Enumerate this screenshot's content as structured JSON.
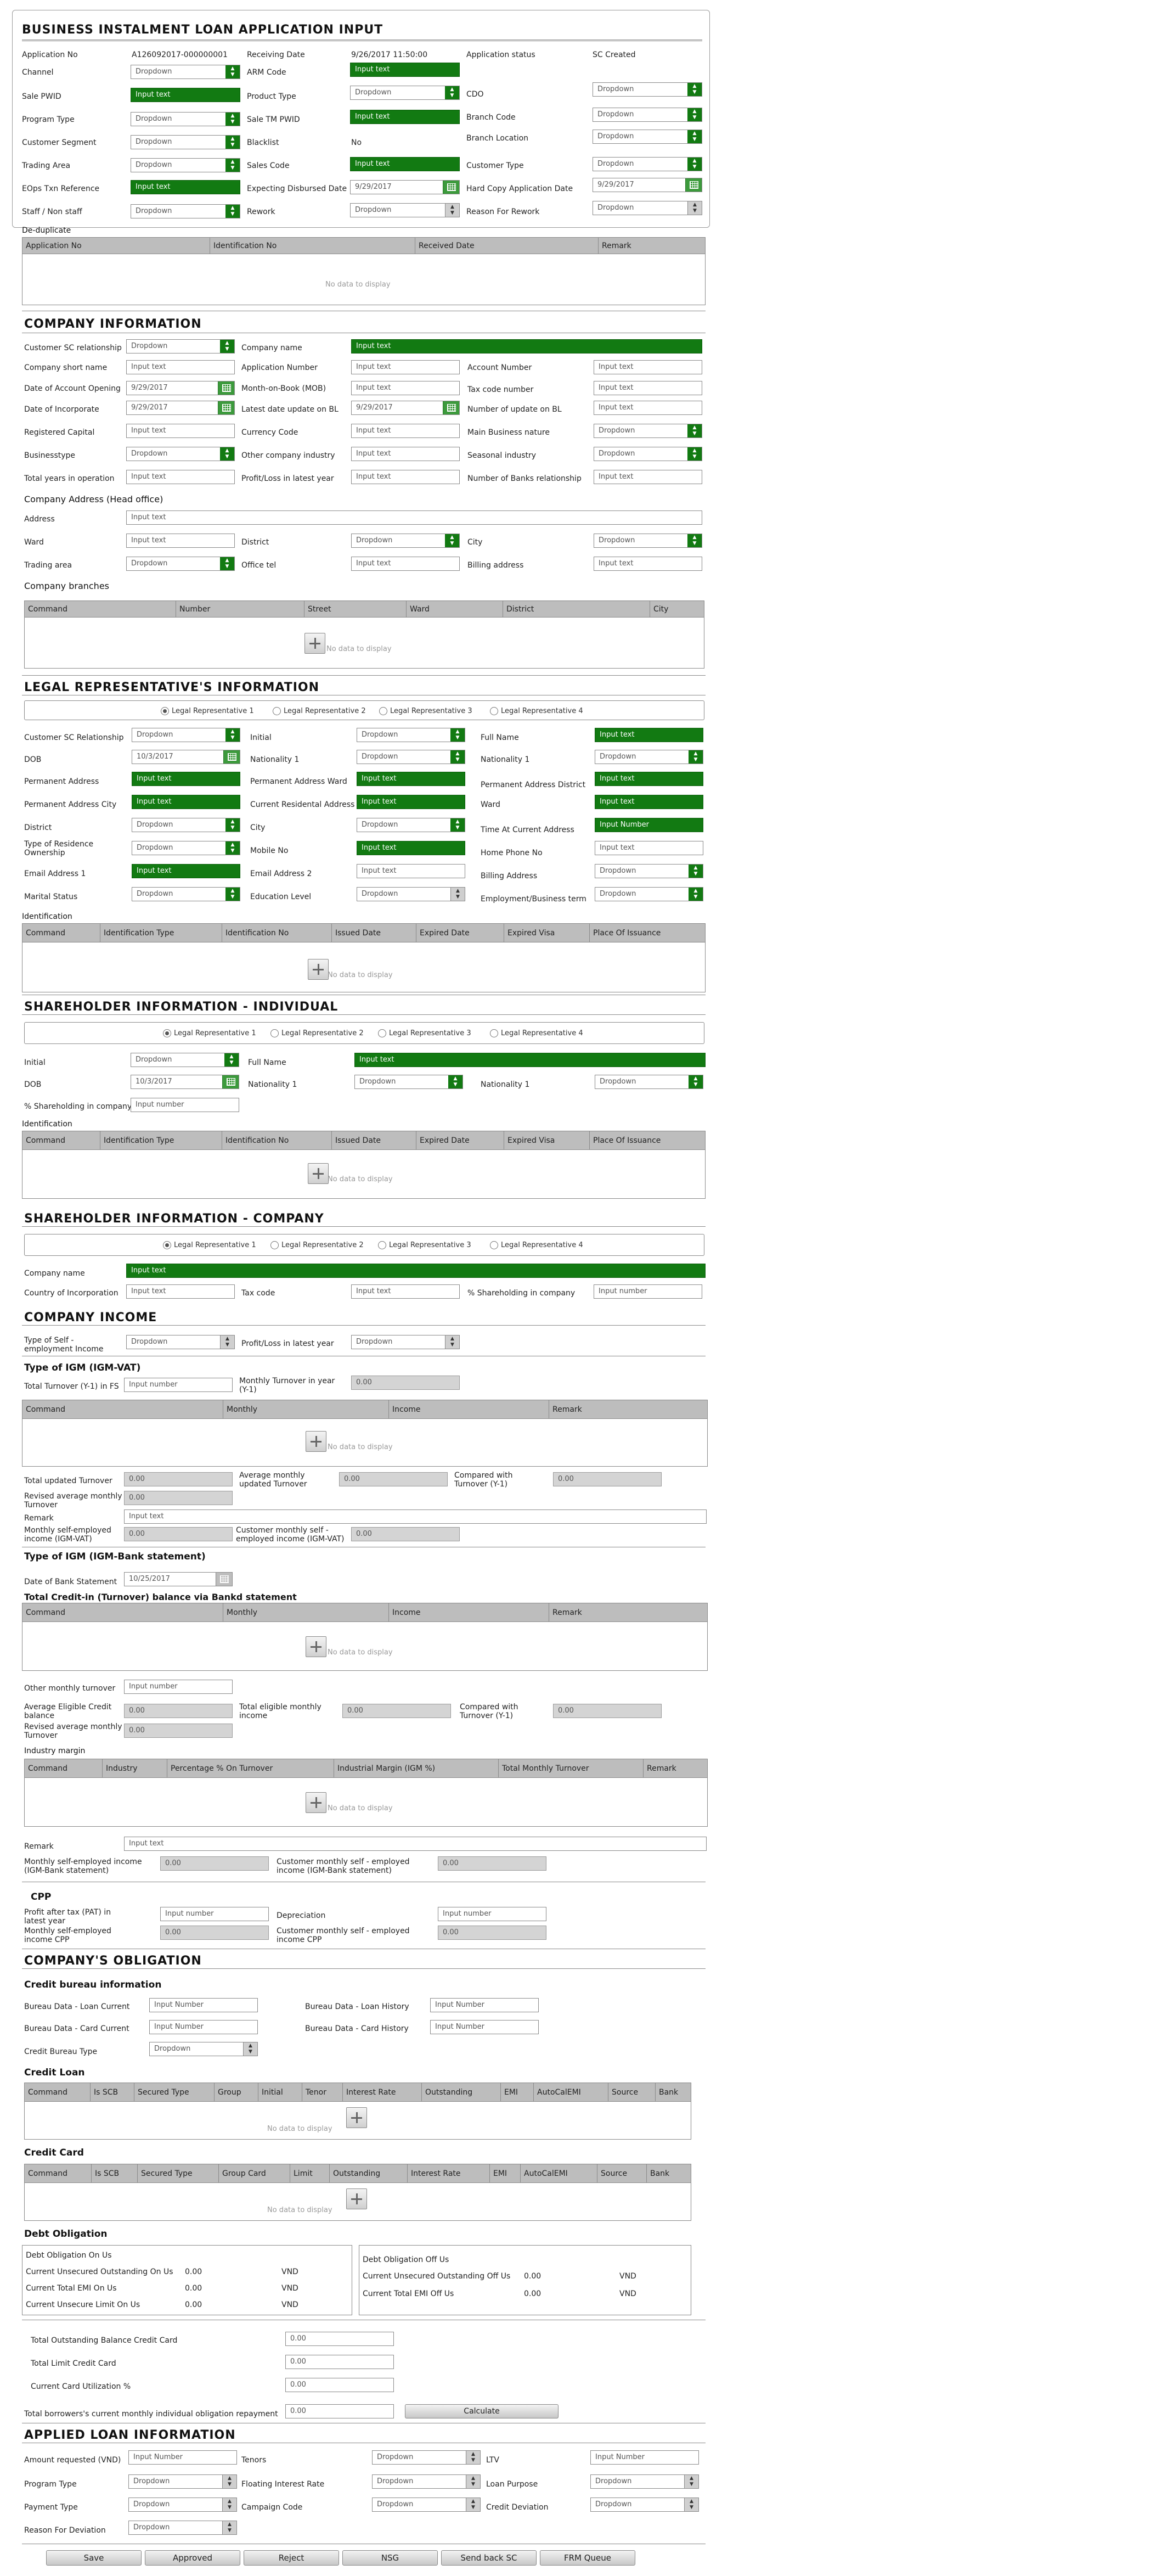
{
  "header": {
    "title": "BUSINESS INSTALMENT LOAN APPLICATION INPUT",
    "app_no_label": "Application No",
    "app_no": "A1260920​17-000000001",
    "receiving_date_label": "Receiving Date",
    "receiving_date": "9/26/2017 11:50:00",
    "app_status_label": "Application status",
    "app_status": "SC Created",
    "channel": "Channel",
    "arm_code": "ARM Code",
    "sale_pwid": "Sale PWID",
    "product_type": "Product Type",
    "cdo": "CDO",
    "program_type": "Program Type",
    "sale_tm_pwid": "Sale TM PWID",
    "branch_code": "Branch Code",
    "customer_segment": "Customer Segment",
    "blacklist": "Blacklist",
    "blacklist_val": "No",
    "branch_location": "Branch Location",
    "trading_area": "Trading Area",
    "sales_code": "Sales Code",
    "customer_type": "Customer Type",
    "eops_ref": "EOps Txn Reference",
    "expecting_date": "Expecting Disbursed Date",
    "expecting_date_val": "9/29/2017",
    "hardcopy_date": "Hard Copy Application Date",
    "hardcopy_date_val": "9/29/2017",
    "staff": "Staff / Non staff",
    "rework": "Rework",
    "reason_rework": "Reason For Rework"
  },
  "common": {
    "dropdown": "Dropdown",
    "input_text": "Input text",
    "input_number": "Input number",
    "input_number_cap": "Input Number",
    "no_data": "No data to display",
    "zero": "0.00",
    "vnd": "VND"
  },
  "dedup": {
    "title": "De-duplicate",
    "cols": [
      "Application No",
      "Identification No",
      "Received Date",
      "Remark"
    ]
  },
  "company": {
    "title": "COMPANY INFORMATION",
    "customer_sc_rel": "Customer SC relationship",
    "company_name": "Company name",
    "short_name": "Company short name",
    "application_number": "Application Number",
    "account_number": "Account Number",
    "date_account_opening": "Date of Account Opening",
    "date_account_opening_val": "9/29/2017",
    "mob": "Month-on-Book (MOB)",
    "tax_code_number": "Tax code number",
    "date_incorporate": "Date of Incorporate",
    "date_incorporate_val": "9/29/2017",
    "latest_update": "Latest date update on BL",
    "latest_update_val": "9/29/2017",
    "num_update": "Number of update on BL",
    "registered_capital": "Registered Capital",
    "currency_code": "Currency Code",
    "main_business": "Main Business nature",
    "business_type": "Businesstype",
    "other_industry": "Other company industry",
    "seasonal": "Seasonal industry",
    "total_years": "Total years in operation",
    "profit_loss": "Profit/Loss in latest year",
    "num_banks": "Number of Banks relationship",
    "address_title": "Company Address (Head office)",
    "address": "Address",
    "ward": "Ward",
    "district": "District",
    "city": "City",
    "trading_area": "Trading area",
    "office_tel": "Office tel",
    "billing_address": "Billing address",
    "branches_title": "Company branches",
    "branch_cols": [
      "Command",
      "Number",
      "Street",
      "Ward",
      "District",
      "City"
    ]
  },
  "legal": {
    "title": "LEGAL REPRESENTATIVE'S INFORMATION",
    "radios": [
      "Legal Representative 1",
      "Legal Representative 2",
      "Legal Representative 3",
      "Legal Representative 4"
    ],
    "customer_sc_rel": "Customer SC Relationship",
    "initial": "Initial",
    "full_name": "Full Name",
    "dob": "DOB",
    "dob_val": "10/3/2017",
    "nationality1": "Nationality 1",
    "perm_address": "Permanent Address",
    "perm_ward": "Permanent Address Ward",
    "perm_district": "Permanent Address District",
    "perm_city": "Permanent Address City",
    "current_address": "Current Residental Address",
    "ward": "Ward",
    "district": "District",
    "city": "City",
    "time_current": "Time At Current Address",
    "input_number_cap": "Input Number",
    "residence_type": "Type of Residence Ownership",
    "mobile_no": "Mobile No",
    "home_phone": "Home Phone No",
    "email1": "Email Address 1",
    "email2": "Email Address 2",
    "billing_address": "Billing Address",
    "marital": "Marital Status",
    "education": "Education Level",
    "employment": "Employment/Business term",
    "ident_title": "Identification",
    "ident_cols": [
      "Command",
      "Identification Type",
      "Identification No",
      "Issued Date",
      "Expired Date",
      "Expired Visa",
      "Place Of Issuance"
    ]
  },
  "sh_ind": {
    "title": "SHAREHOLDER INFORMATION - INDIVIDUAL",
    "initial": "Initial",
    "full_name": "Full Name",
    "dob": "DOB",
    "dob_val": "10/3/2017",
    "nationality1": "Nationality 1",
    "nationality1b": "Nationality 1",
    "pct": "% Shareholding in company",
    "ident_title": "Identification"
  },
  "sh_co": {
    "title": "SHAREHOLDER INFORMATION - COMPANY",
    "company_name": "Company name",
    "country": "Country of Incorporation",
    "tax_code": "Tax code",
    "pct": "% Shareholding in company"
  },
  "income": {
    "title": "COMPANY INCOME",
    "type_self": "Type of Self - employment Income",
    "profit_loss": "Profit/Loss in latest year",
    "igm_vat_title": "Type of IGM (IGM-VAT)",
    "total_turnover": "Total Turnover (Y-1) in FS",
    "monthly_turnover": "Monthly Turnover in year (Y-1)",
    "vat_cols": [
      "Command",
      "Monthly",
      "Income",
      "Remark"
    ],
    "updated_turnover": "Total updated Turnover",
    "avg_monthly": "Average monthly updated Turnover",
    "compared": "Compared with Turnover (Y-1)",
    "revised_avg": "Revised average monthly Turnover",
    "remark": "Remark",
    "monthly_self_vat": "Monthly self-employed income (IGM-VAT)",
    "customer_monthly_vat": "Customer monthly self - employed income (IGM-VAT)",
    "igm_bank_title": "Type of IGM (IGM-Bank statement)",
    "date_bank": "Date of Bank Statement",
    "date_bank_val": "10/25/2017",
    "credit_title": "Total Credit-in (Turnover) balance via Bankd statement",
    "other_turnover": "Other monthly turnover",
    "avg_credit": "Average Eligible Credit balance",
    "total_eligible": "Total eligible monthly income",
    "compared2": "Compared with Turnover (Y-1)",
    "revised_avg2": "Revised average monthly Turnover",
    "industry_title": "Industry margin",
    "industry_cols": [
      "Command",
      "Industry",
      "Percentage % On Turnover",
      "Industrial Margin (IGM %)",
      "Total Monthly Turnover",
      "Remark"
    ],
    "monthly_self_bank": "Monthly self-employed income (IGM-Bank statement)",
    "customer_monthly_bank": "Customer monthly self - employed income (IGM-Bank statement)",
    "cpp_title": "CPP",
    "pat": "Profit after tax (PAT) in latest year",
    "depreciation": "Depreciation",
    "monthly_cpp": "Monthly self-employed income CPP",
    "customer_cpp": "Customer monthly self - employed income CPP"
  },
  "obligation": {
    "title": "COMPANY'S OBLIGATION",
    "bureau_title": "Credit bureau information",
    "bureau_loan_current": "Bureau Data - Loan Current",
    "bureau_loan_history": "Bureau Data - Loan History",
    "bureau_card_current": "Bureau Data - Card Current",
    "bureau_card_history": "Bureau Data - Card History",
    "bureau_type": "Credit Bureau Type",
    "credit_loan_title": "Credit Loan",
    "loan_cols": [
      "Command",
      "Is SCB",
      "Secured Type",
      "Group",
      "Initial",
      "Tenor",
      "Interest Rate",
      "Outstanding",
      "EMI",
      "AutoCalEMI",
      "Source",
      "Bank"
    ],
    "credit_card_title": "Credit Card",
    "card_cols": [
      "Command",
      "Is SCB",
      "Secured Type",
      "Group Card",
      "Limit",
      "Outstanding",
      "Interest Rate",
      "EMI",
      "AutoCalEMI",
      "Source",
      "Bank"
    ],
    "debt_title": "Debt Obligation",
    "on_us_title": "Debt Obligation On Us",
    "off_us_title": "Debt Obligation Off Us",
    "cur_unsec_on": "Current Unsecured Outstanding On Us",
    "cur_emi_on": "Current Total EMI On Us",
    "cur_limit_on": "Current Unsecure Limit On Us",
    "cur_unsec_off": "Current Unsecured Outstanding Off Us",
    "cur_emi_off": "Current Total EMI Off Us",
    "total_outstanding_cc": "Total Outstanding Balance Credit Card",
    "total_limit_cc": "Total Limit Credit Card",
    "card_util": "Current Card Utilization %",
    "total_repayment": "Total borrowers's current monthly individual obligation repayment",
    "calculate": "Calculate"
  },
  "applied": {
    "title": "APPLIED LOAN INFORMATION",
    "amount": "Amount requested (VND)",
    "tenors": "Tenors",
    "ltv": "LTV",
    "program_type": "Program Type",
    "floating_rate": "Floating Interest Rate",
    "loan_purpose": "Loan Purpose",
    "payment_type": "Payment Type",
    "campaign_code": "Campaign Code",
    "credit_deviation": "Credit Deviation",
    "reason_deviation": "Reason For Deviation"
  },
  "buttons": {
    "save": "Save",
    "approved": "Approved",
    "reject": "Reject",
    "nsg": "NSG",
    "send_back": "Send back SC",
    "frm_queue": "FRM Queue"
  }
}
